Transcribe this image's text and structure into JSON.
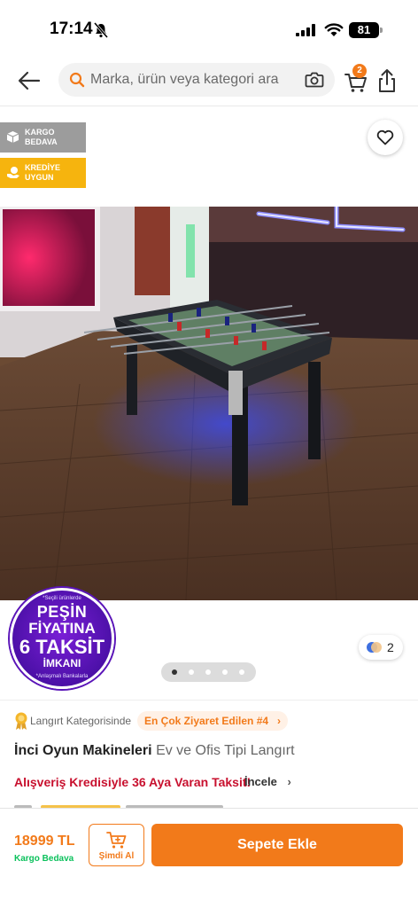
{
  "status_bar": {
    "time": "17:14",
    "battery": "81"
  },
  "header": {
    "search_placeholder": "Marka, ürün veya kategori ara",
    "cart_count": "2"
  },
  "badges": {
    "cargo": "KARGO BEDAVA",
    "credit": "KREDİYE UYGUN"
  },
  "promo": {
    "top_small": "*Seçili ürünlerde",
    "line1": "PEŞİN",
    "line2": "FİYATINA",
    "line3": "6 TAKSİT",
    "line4": "İMKANI",
    "bottom_small": "*Anlaşmalı Bankalarla"
  },
  "gallery": {
    "variant_count": "2",
    "page_count": 5,
    "active_page": 1
  },
  "product": {
    "category_text": "Langırt Kategorisinde",
    "rank": "En Çok Ziyaret Edilen #4",
    "brand": "İnci Oyun Makineleri",
    "name": "Ev ve Ofis Tipi Langırt",
    "credit_text": "Alışveriş Kredisiyle 36 Aya Varan Taksit!",
    "review_label": "İncele"
  },
  "bottom_bar": {
    "price": "18999 TL",
    "shipping": "Kargo Bedava",
    "buy_now": "Şimdi Al",
    "add_to_cart": "Sepete Ekle"
  },
  "colors": {
    "accent": "#f27a1a",
    "credit_red": "#c8102e",
    "shipping_green": "#0bc15c",
    "credit_badge": "#f6b40e",
    "cargo_badge": "#9c9c9c"
  },
  "icons": [
    "back-arrow-icon",
    "search-icon",
    "camera-icon",
    "cart-icon",
    "share-icon",
    "heart-icon",
    "box-icon",
    "money-icon",
    "medal-icon",
    "chevron-right-icon"
  ]
}
